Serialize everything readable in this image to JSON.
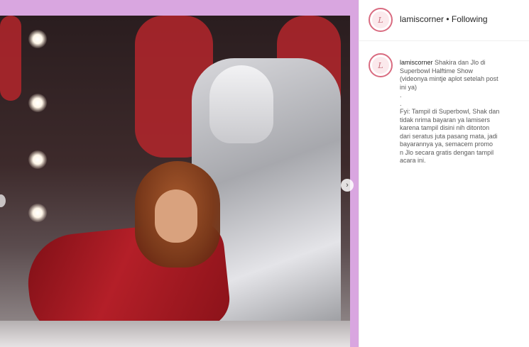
{
  "post": {
    "header": {
      "username": "lamiscorner",
      "separator": "•",
      "follow_state": "Following",
      "avatar_glyph": "L"
    },
    "caption": {
      "username": "lamiscorner",
      "text": "Shakira dan Jlo di\nSuperbowl Halftime Show\n(videonya mintje aplot setelah post\nini ya)\n.\n.\nFyi: Tampil di Superbowl, Shak dan\ntidak nrima bayaran ya lamisers\nkarena tampil disini nih ditonton\ndari seratus juta pasang mata, jadi\nbayarannya ya, semacem promo\nn Jlo secara gratis dengan tampil\nacara ini."
    }
  },
  "colors": {
    "frame": "#d9a6e0",
    "avatar_ring": "#d96b80"
  },
  "icons": {
    "carousel_next": "chevron-right-icon"
  }
}
